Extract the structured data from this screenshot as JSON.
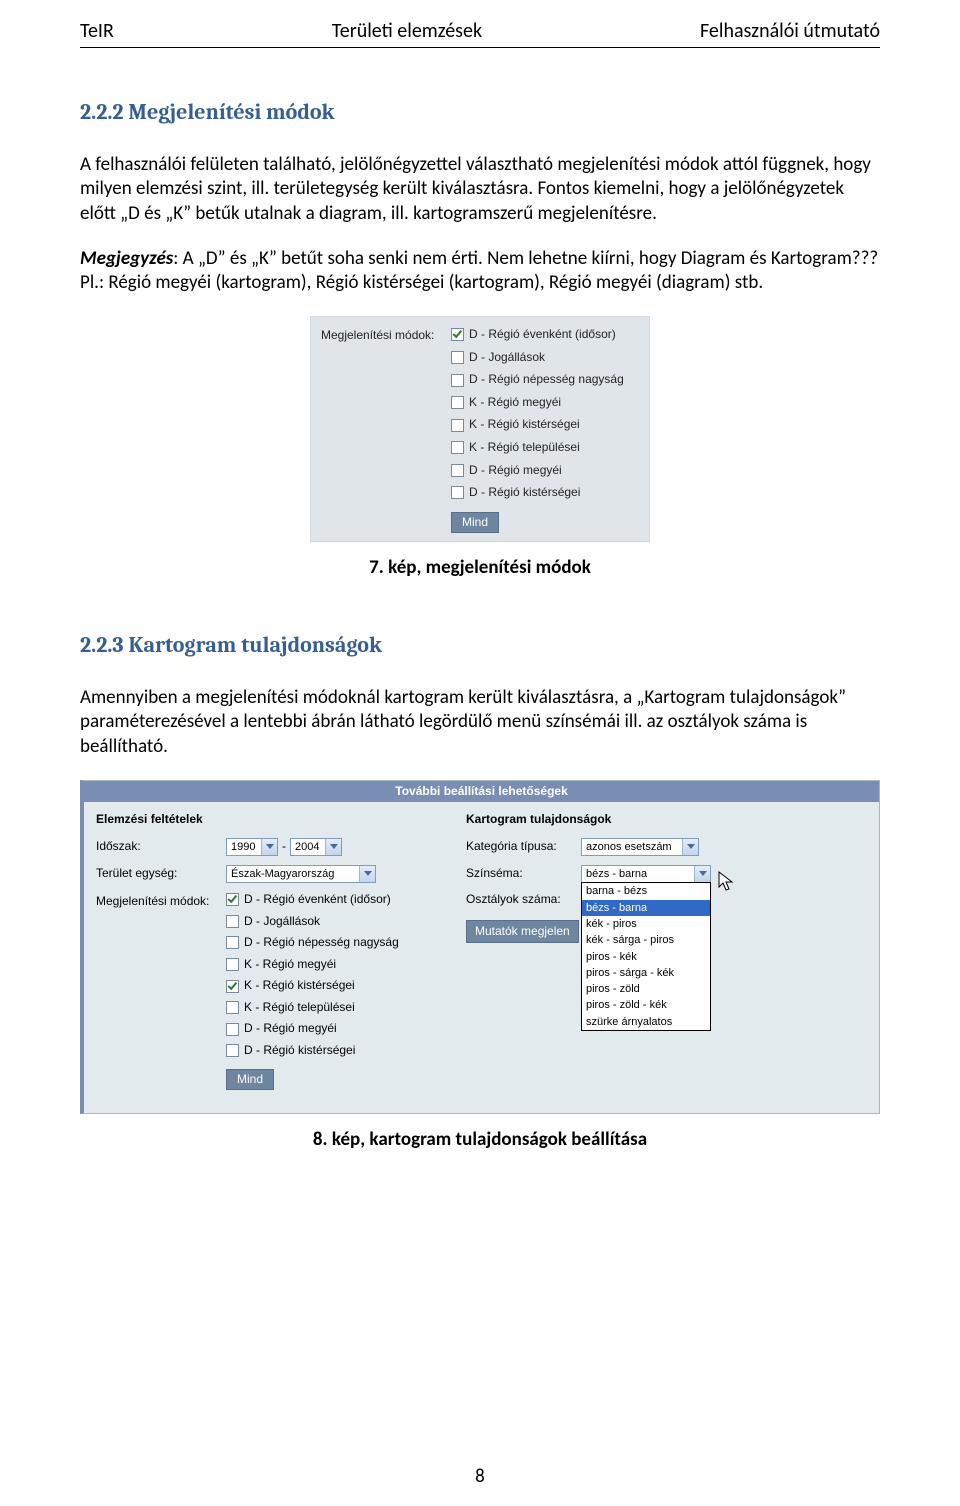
{
  "header": {
    "left": "TeIR",
    "center": "Területi elemzések",
    "right": "Felhasználói útmutató"
  },
  "section1": {
    "heading": "2.2.2 Megjelenítési módok",
    "para1": "A felhasználói felületen található, jelölőnégyzettel választható megjelenítési módok attól függnek, hogy milyen elemzési szint, ill. területegység került kiválasztásra. Fontos kiemelni, hogy a jelölőnégyzetek előtt „D és „K” betűk utalnak a diagram, ill. kartogramszerű megjelenítésre.",
    "comment_label": "Megjegyzés",
    "comment_text": ": A „D” és „K” betűt soha senki nem érti. Nem lehetne kiírni, hogy Diagram és Kartogram??? Pl.: Régió megyéi (kartogram), Régió kistérségei (kartogram), Régió megyéi (diagram) stb."
  },
  "fig1": {
    "label": "Megjelenítési módok:",
    "items": [
      {
        "label": "D - Régió évenként (idősor)",
        "checked": true
      },
      {
        "label": "D - Jogállások",
        "checked": false
      },
      {
        "label": "D - Régió népesség nagyság",
        "checked": false
      },
      {
        "label": "K - Régió megyéi",
        "checked": false
      },
      {
        "label": "K - Régió kistérségei",
        "checked": false
      },
      {
        "label": "K - Régió települései",
        "checked": false
      },
      {
        "label": "D - Régió megyéi",
        "checked": false
      },
      {
        "label": "D - Régió kistérségei",
        "checked": false
      }
    ],
    "button": "Mind",
    "caption": "7. kép, megjelenítési módok"
  },
  "section2": {
    "heading": "2.2.3 Kartogram tulajdonságok",
    "para": "Amennyiben a megjelenítési módoknál kartogram került kiválasztásra, a „Kartogram tulajdonságok” paraméterezésével a lentebbi ábrán látható legördülő menü színsémái ill. az osztályok száma is beállítható."
  },
  "fig2": {
    "title": "További beállítási lehetőségek",
    "left": {
      "heading": "Elemzési feltételek",
      "period_label": "Időszak:",
      "period_from": "1990",
      "period_to": "2004",
      "area_label": "Terület egység:",
      "area_value": "Észak-Magyarország",
      "modes_label": "Megjelenítési módok:",
      "modes": [
        {
          "label": "D - Régió évenként (idősor)",
          "checked": true
        },
        {
          "label": "D - Jogállások",
          "checked": false
        },
        {
          "label": "D - Régió népesség nagyság",
          "checked": false
        },
        {
          "label": "K - Régió megyéi",
          "checked": false
        },
        {
          "label": "K - Régió kistérségei",
          "checked": true
        },
        {
          "label": "K - Régió települései",
          "checked": false
        },
        {
          "label": "D - Régió megyéi",
          "checked": false
        },
        {
          "label": "D - Régió kistérségei",
          "checked": false
        }
      ],
      "button": "Mind"
    },
    "right": {
      "heading": "Kartogram tulajdonságok",
      "category_label": "Kategória típusa:",
      "category_value": "azonos esetszám",
      "scheme_label": "Színséma:",
      "scheme_value": "bézs - barna",
      "classes_label": "Osztályok száma:",
      "button": "Mutatók megjelen",
      "options": [
        "barna - bézs",
        "bézs - barna",
        "kék - piros",
        "kék - sárga - piros",
        "piros - kék",
        "piros - sárga - kék",
        "piros - zöld",
        "piros - zöld - kék",
        "szürke árnyalatos"
      ],
      "selected_option": "bézs - barna"
    },
    "caption": "8. kép, kartogram tulajdonságok beállítása"
  },
  "page_number": "8"
}
